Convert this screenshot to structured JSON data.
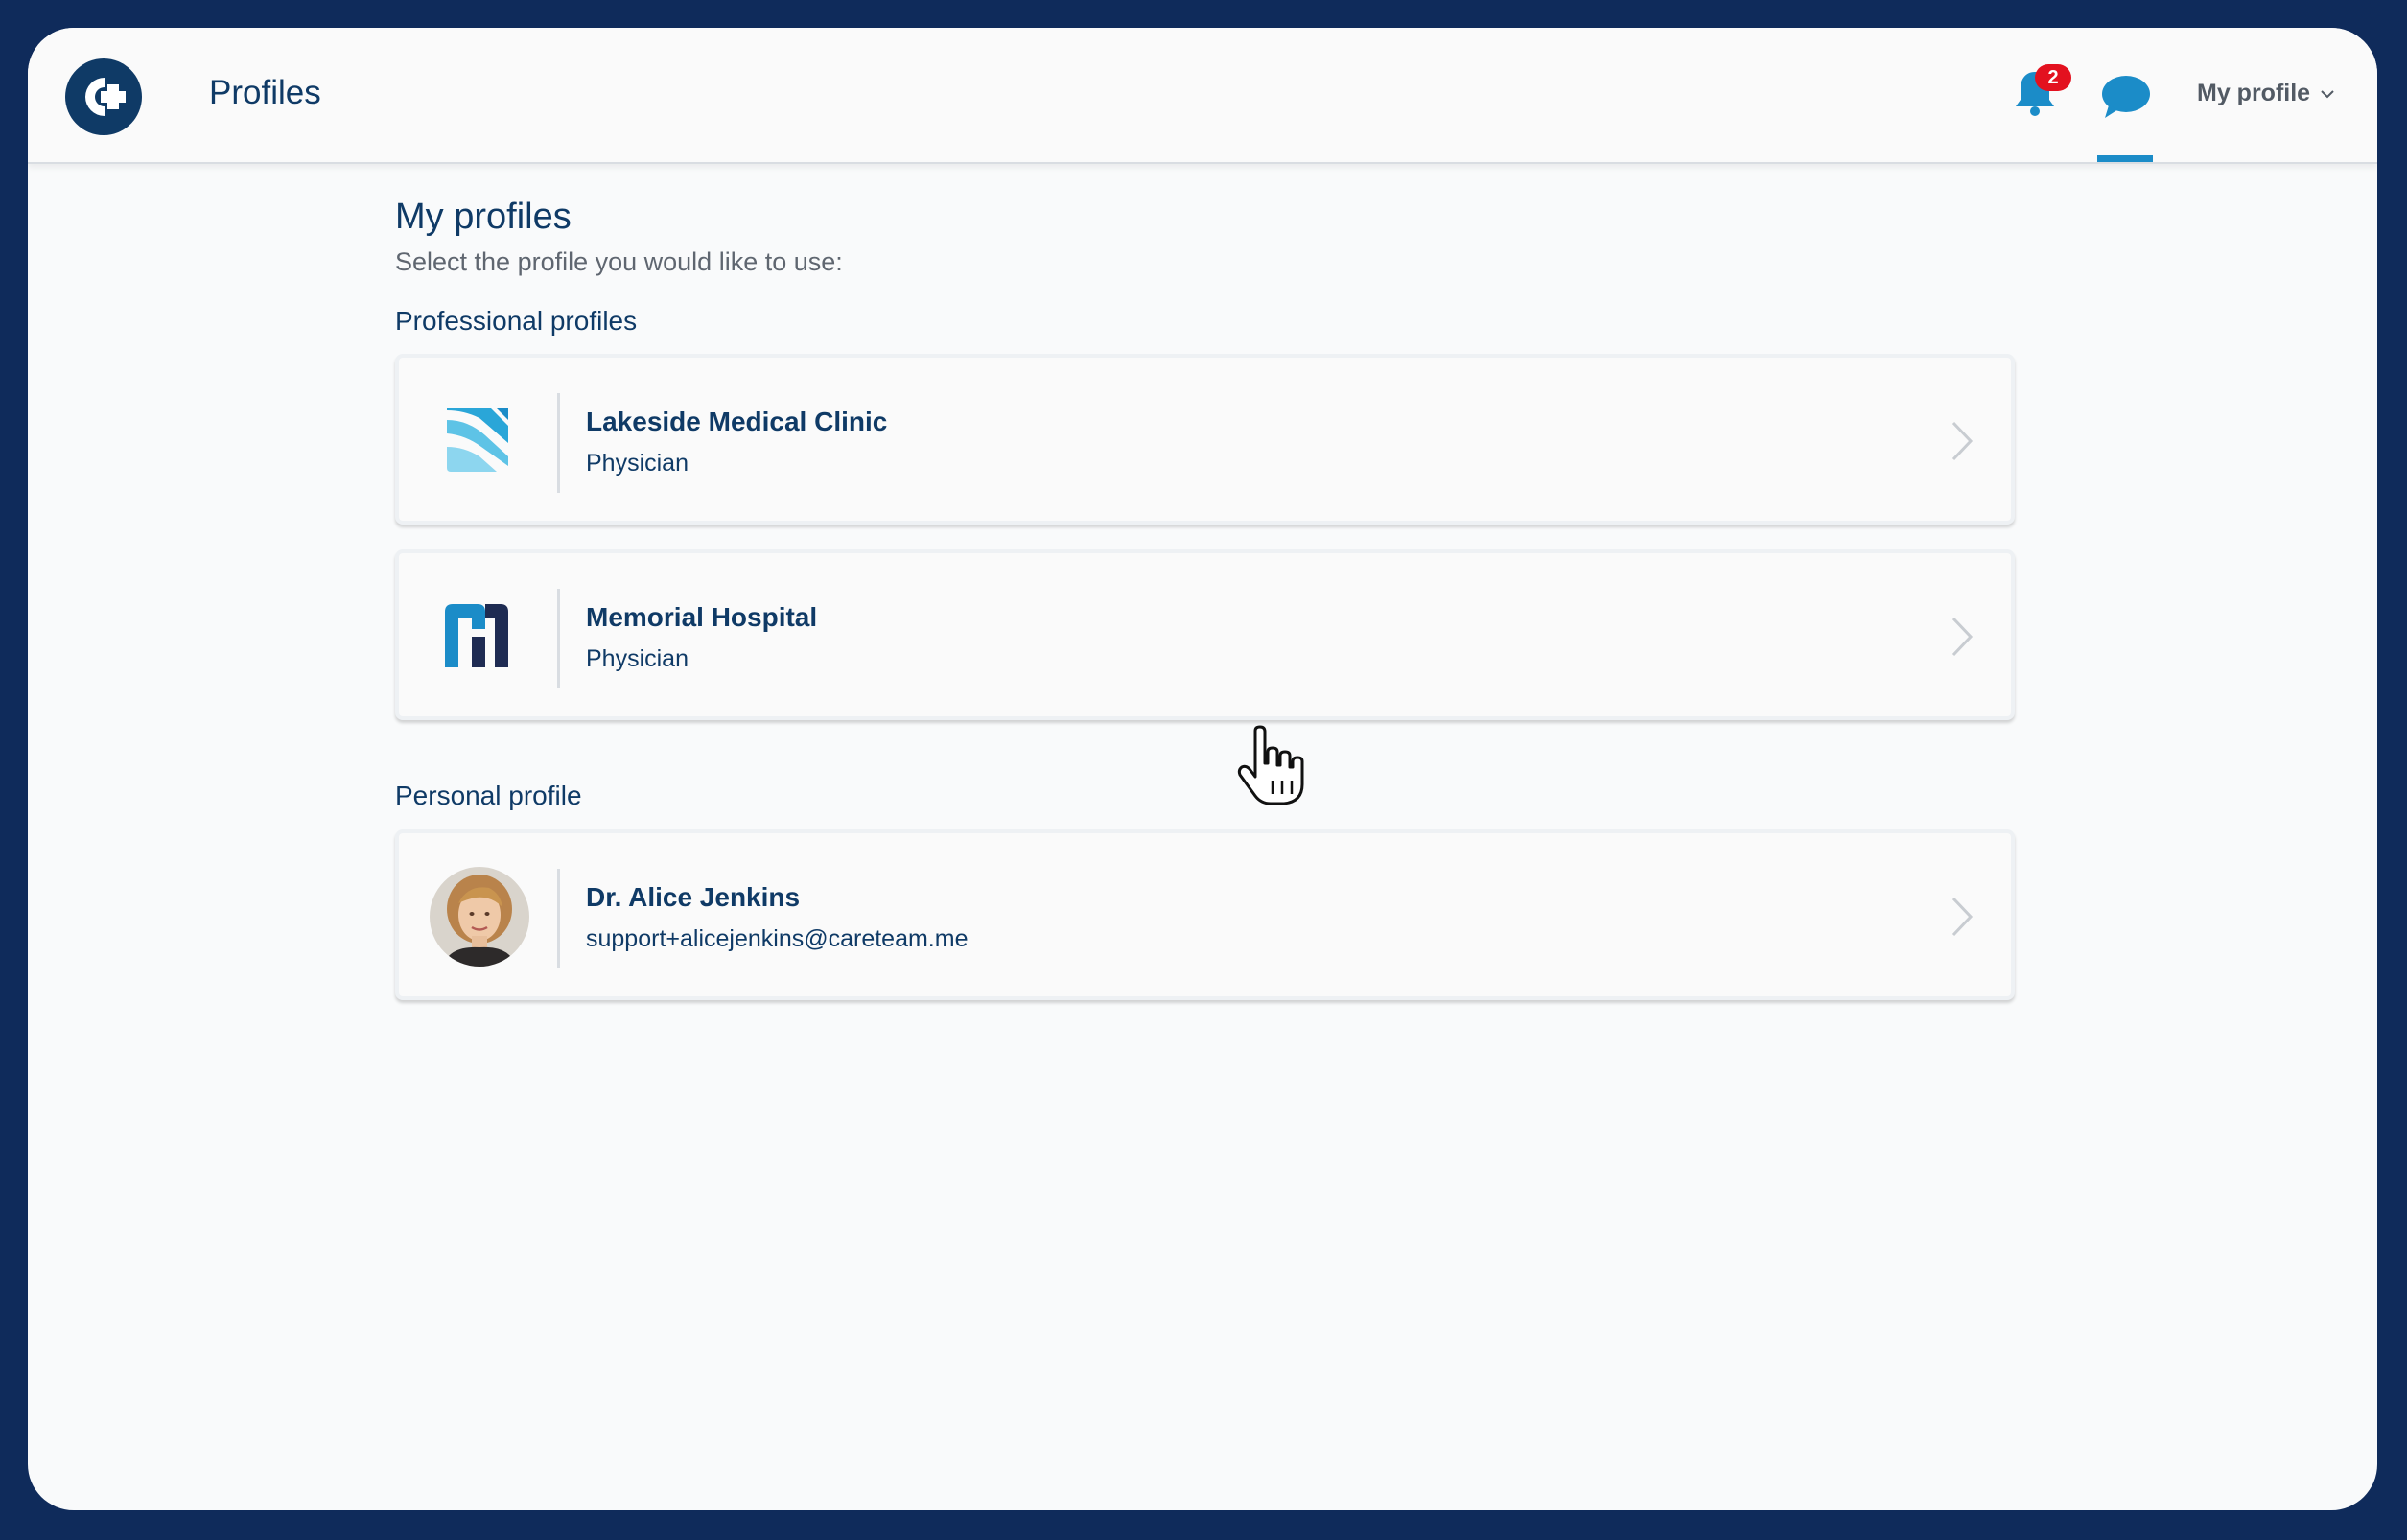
{
  "header": {
    "title": "Profiles",
    "notifications_count": "2",
    "my_profile_label": "My profile"
  },
  "main": {
    "title": "My profiles",
    "subtitle": "Select the profile you would like to use:",
    "professional_section_label": "Professional profiles",
    "personal_section_label": "Personal profile",
    "professional_profiles": [
      {
        "name": "Lakeside Medical Clinic",
        "role": "Physician",
        "logo": "lakeside-logo"
      },
      {
        "name": "Memorial Hospital",
        "role": "Physician",
        "logo": "memorial-hospital-logo"
      }
    ],
    "personal_profile": {
      "name": "Dr. Alice Jenkins",
      "email": "support+alicejenkins@careteam.me"
    }
  },
  "colors": {
    "frame": "#0f2b5b",
    "primary": "#0f3a66",
    "accent": "#1b8cc8",
    "badge": "#e3111f"
  }
}
